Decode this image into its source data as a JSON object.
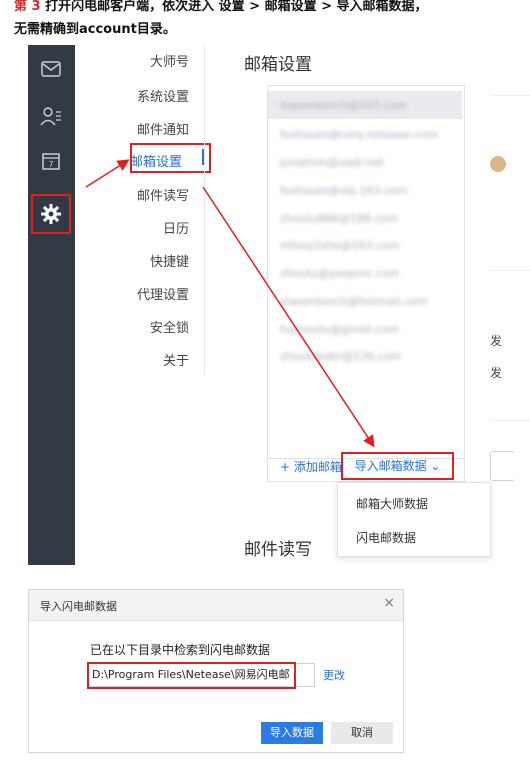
{
  "intro": {
    "line1_prefix": "第 3 ",
    "line1_text": "打开闪电邮客户端，依次进入 设置 > 邮箱设置 > 导入邮箱数据，",
    "line2": "无需精确到account目录。"
  },
  "sidebar": {
    "icons": [
      "mail-icon",
      "contacts-icon",
      "calendar-icon",
      "gear-icon"
    ],
    "calendar_day": "7"
  },
  "menu": {
    "items": [
      "大师号",
      "系统设置",
      "邮件通知",
      "邮箱设置",
      "邮件读写",
      "日历",
      "快捷键",
      "代理设置",
      "安全锁",
      "关于"
    ],
    "active_index": 3
  },
  "section": {
    "mailbox_settings": "邮箱设置",
    "mail_rw": "邮件读写"
  },
  "accounts": [
    "xiaoenborch@163.com",
    "fuzhouto@corp.netease.com",
    "junqimin@vadr.net",
    "fuzhouto@vip.163.com",
    "zhoutu666@188.com",
    "mfoxy2zhe@163.com",
    "zhoutu@yeepmc.com",
    "xiaoenborch@hotmail.com",
    "fujthoutu@gmail.com",
    "zhoukfpdbr@126.com"
  ],
  "actions": {
    "add_mailbox": "+ 添加邮箱",
    "import_data": "导入邮箱数据 ⌄"
  },
  "dropdown": {
    "items": [
      "邮箱大师数据",
      "闪电邮数据"
    ]
  },
  "right_col": {
    "label1": "发",
    "label2": "发"
  },
  "dialog": {
    "title": "导入闪电邮数据",
    "close": "×",
    "info": "已在以下目录中检索到闪电邮数据",
    "path": "D:\\Program Files\\Netease\\网易闪电邮",
    "change": "更改",
    "import_button": "导入数据",
    "cancel_button": "取消"
  },
  "colors": {
    "sidebar_bg": "#323a45",
    "accent": "#2c6fd6",
    "highlight_red": "#e02020",
    "primary_button": "#2c7be5"
  }
}
